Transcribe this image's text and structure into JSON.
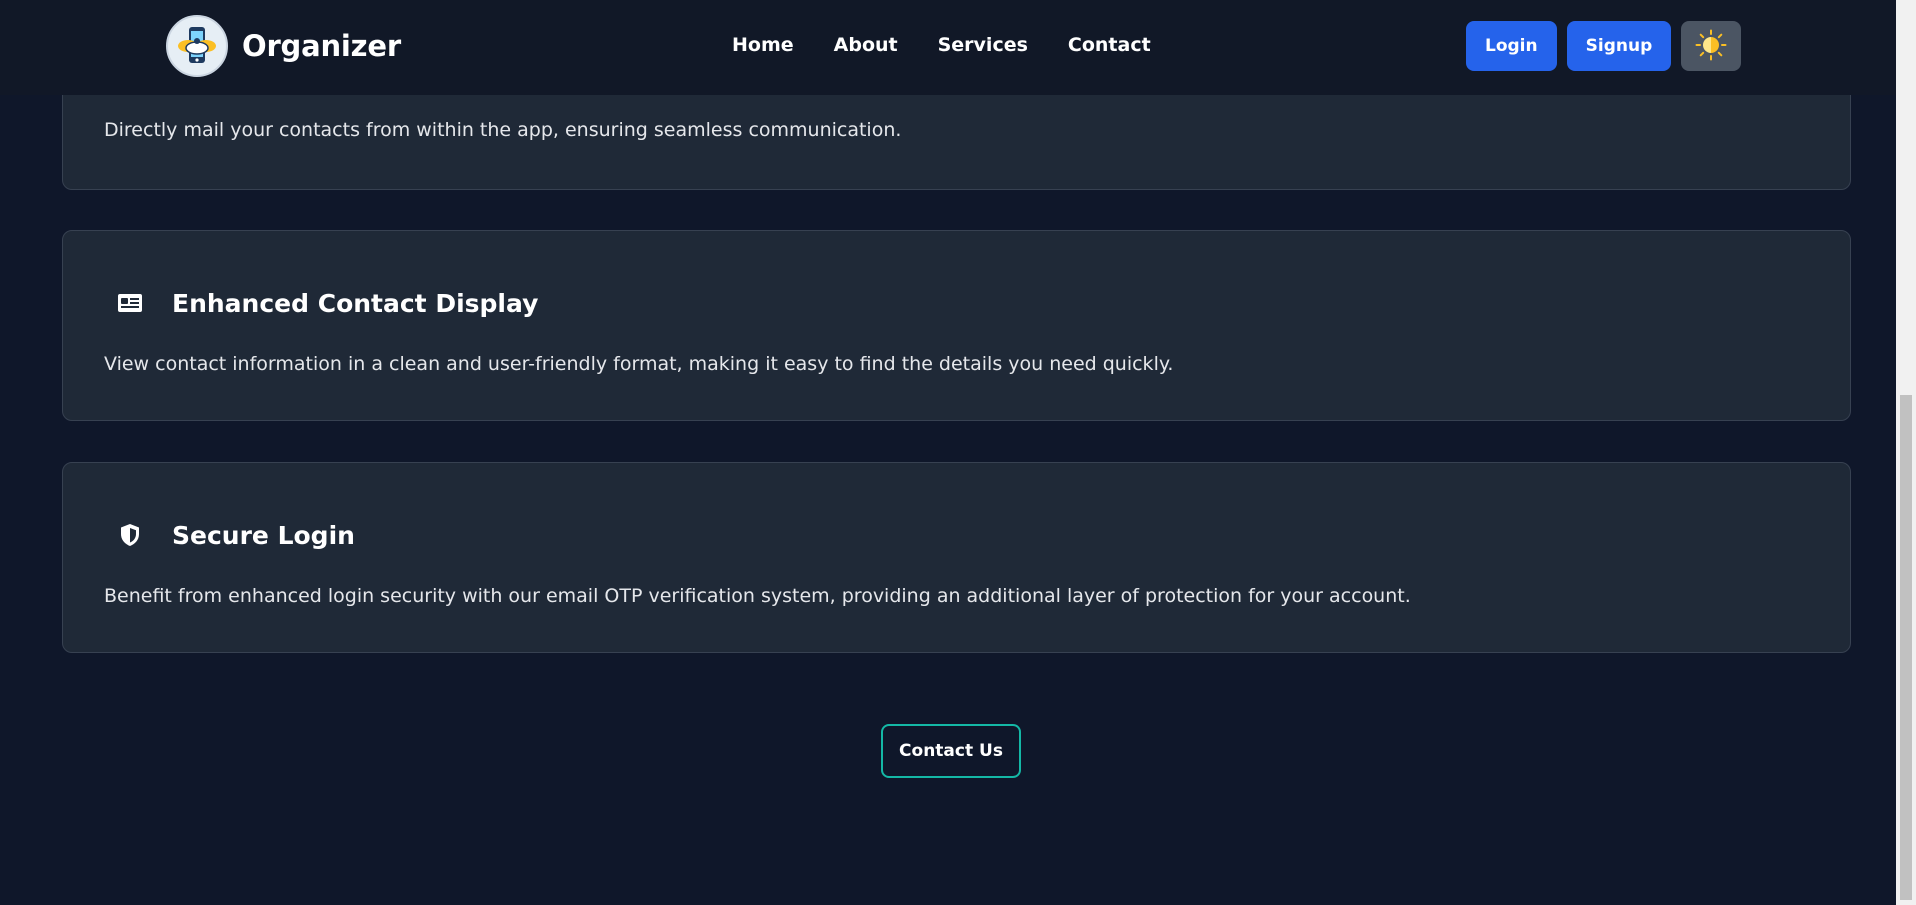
{
  "brand": {
    "name": "Organizer"
  },
  "nav": {
    "links": [
      {
        "label": "Home"
      },
      {
        "label": "About"
      },
      {
        "label": "Services"
      },
      {
        "label": "Contact"
      }
    ],
    "login_label": "Login",
    "signup_label": "Signup",
    "theme_icon": "sun-icon"
  },
  "features": [
    {
      "title": "",
      "description": "Directly mail your contacts from within the app, ensuring seamless communication."
    },
    {
      "icon": "id-card-icon",
      "title": "Enhanced Contact Display",
      "description": "View contact information in a clean and user-friendly format, making it easy to find the details you need quickly."
    },
    {
      "icon": "shield-icon",
      "title": "Secure Login",
      "description": "Benefit from enhanced login security with our email OTP verification system, providing an additional layer of protection for your account."
    }
  ],
  "cta": {
    "label": "Contact Us"
  },
  "colors": {
    "background": "#0f172a",
    "card": "#1f2937",
    "primary": "#2563eb",
    "accent_border": "#14b8a6"
  }
}
